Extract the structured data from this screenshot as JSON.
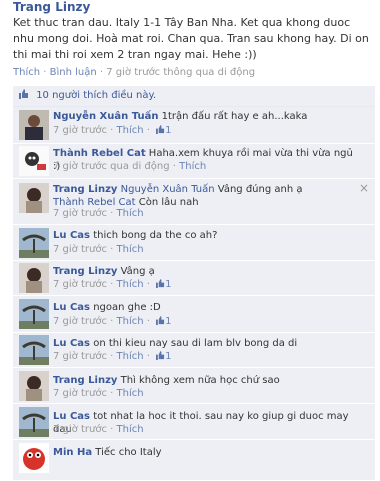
{
  "post": {
    "author": "Trang Linzy",
    "text": "Ket thuc tran dau. Italy 1-1 Tây Ban Nha. Ket qua khong duoc nhu mong doi. Hoà mat roi. Chan qua. Tran sau khong hay. Di on thi mai thi roi xem 2 tran ngay mai. Hehe :))",
    "like_label": "Thích",
    "comment_label": "Bình luận",
    "time": "7 giờ trước thông qua di động"
  },
  "likes": {
    "text": "10 người thích điều này."
  },
  "comments": [
    {
      "name": "Nguyễn Xuân Tuấn",
      "text": "1trận đấu rất hay e ah...kaka",
      "time": "7 giờ trước",
      "like": "Thích",
      "likes": "1"
    },
    {
      "name": "Thành Rebel Cat",
      "text": "Haha.xem khuya rồi mai vừa thi vừa ngủ :)",
      "time": "7 giờ trước qua di động",
      "like": "Thích",
      "likes": ""
    },
    {
      "name": "Trang Linzy",
      "tag1": "Nguyễn Xuân Tuấn",
      "text1": "Vâng đúng anh ạ",
      "tag2": "Thành Rebel Cat",
      "text2": "Còn lâu nah",
      "time": "7 giờ trước",
      "like": "Thích",
      "likes": "",
      "close": "×"
    },
    {
      "name": "Lu Cas",
      "text": "thich bong da the co ah?",
      "time": "7 giờ trước",
      "like": "Thích",
      "likes": ""
    },
    {
      "name": "Trang Linzy",
      "text": "Vâng ạ",
      "time": "7 giờ trước",
      "like": "Thích",
      "likes": "1"
    },
    {
      "name": "Lu Cas",
      "text": "ngoan ghe :D",
      "time": "7 giờ trước",
      "like": "Thích",
      "likes": "1"
    },
    {
      "name": "Lu Cas",
      "text": "on thi kieu nay sau di lam blv bong da di",
      "time": "7 giờ trước",
      "like": "Thích",
      "likes": "1"
    },
    {
      "name": "Trang Linzy",
      "text": "Thì không xem nữa học chứ sao",
      "time": "7 giờ trước",
      "like": "Thích",
      "likes": ""
    },
    {
      "name": "Lu Cas",
      "text": "tot nhat la hoc it thoi. sau nay ko giup gi duoc may dau",
      "time": "7 giờ trước",
      "like": "Thích",
      "likes": ""
    },
    {
      "name": "Min Ha",
      "text": "Tiếc cho Italy",
      "time": "",
      "like": "",
      "likes": ""
    }
  ],
  "colors": {
    "link": "#3b5998",
    "comment_bg": "#edeff4",
    "meta": "#999999"
  }
}
